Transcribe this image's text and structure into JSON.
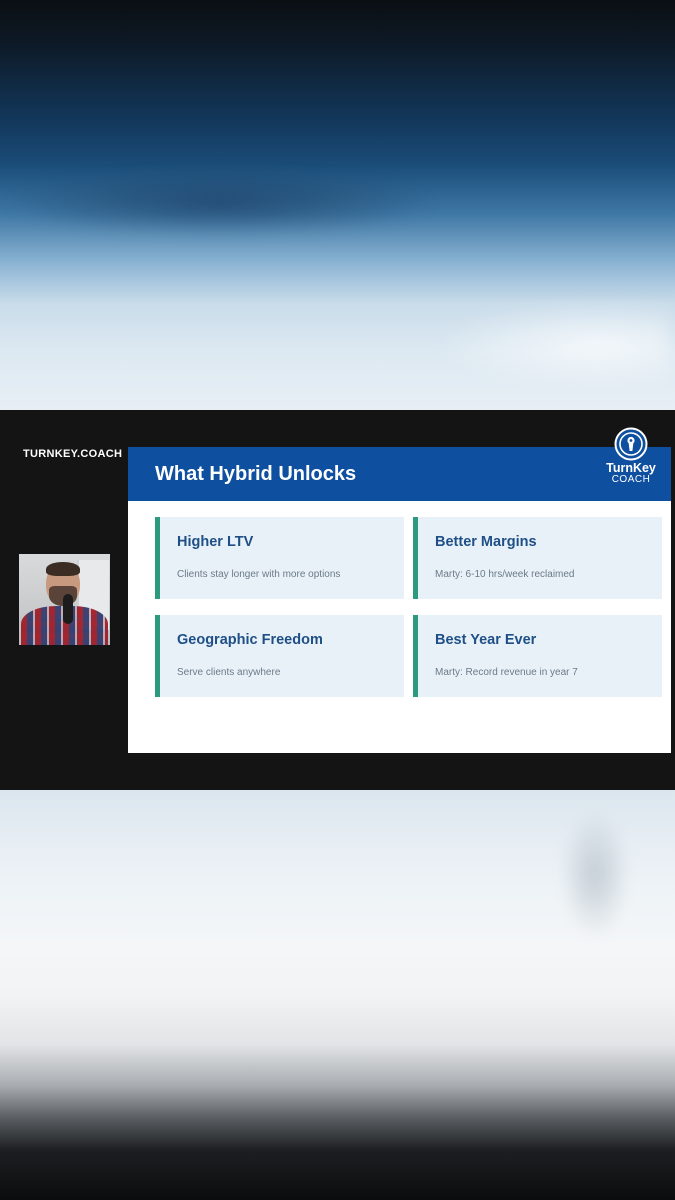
{
  "brand": {
    "site_label": "TURNKEY.COACH",
    "logo_name": "TurnKey",
    "logo_sub": "COACH"
  },
  "slide": {
    "title": "What Hybrid Unlocks",
    "cards": [
      {
        "title": "Higher LTV",
        "desc": "Clients stay longer with more options"
      },
      {
        "title": "Better Margins",
        "desc": "Marty: 6-10 hrs/week reclaimed"
      },
      {
        "title": "Geographic Freedom",
        "desc": "Serve clients anywhere"
      },
      {
        "title": "Best Year Ever",
        "desc": "Marty: Record revenue in year 7"
      }
    ]
  },
  "colors": {
    "header_blue": "#0e4fa0",
    "card_bg": "#e9f1f8",
    "card_accent": "#2e9a7d",
    "card_title": "#1e4f86",
    "band_bg": "#141414"
  }
}
